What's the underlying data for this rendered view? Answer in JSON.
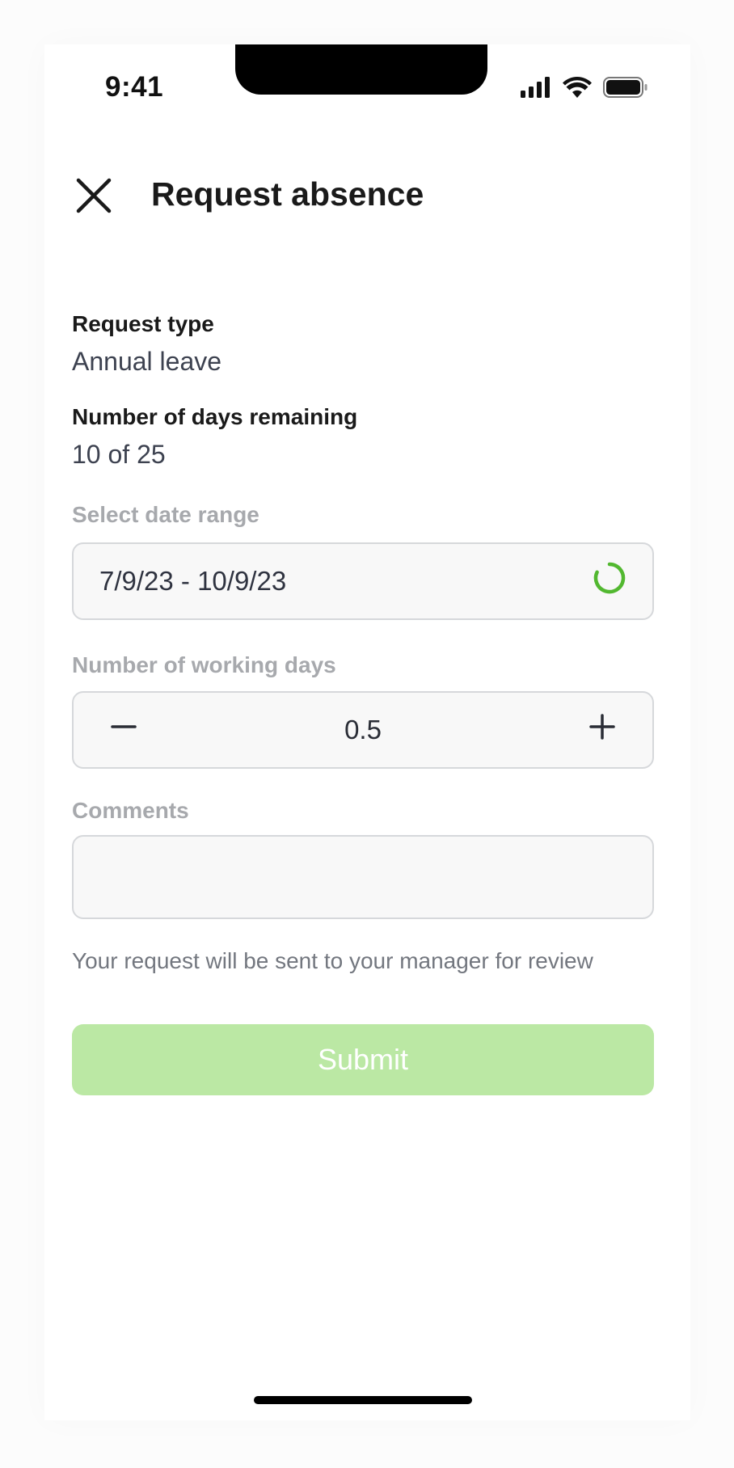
{
  "status_bar": {
    "time": "9:41",
    "icons": [
      "cellular-signal-icon",
      "wifi-icon",
      "battery-icon"
    ]
  },
  "header": {
    "title": "Request absence",
    "close_icon": "close-icon"
  },
  "request_type": {
    "label": "Request type",
    "value": "Annual leave"
  },
  "days_remaining": {
    "label": "Number of days remaining",
    "value": "10 of 25"
  },
  "date_range": {
    "label": "Select date range",
    "value": "7/9/23 - 10/9/23",
    "loading_icon": "loading-spinner-icon"
  },
  "working_days": {
    "label": "Number of working days",
    "value": "0.5",
    "decrement_icon": "minus-icon",
    "increment_icon": "plus-icon"
  },
  "comments": {
    "label": "Comments",
    "value": "",
    "placeholder": ""
  },
  "note": "Your request will be sent to your manager for review",
  "submit": {
    "label": "Submit"
  },
  "colors": {
    "accent": "#52b830",
    "submit_disabled": "#bbe8a4",
    "muted_label": "#a7a9ad"
  }
}
